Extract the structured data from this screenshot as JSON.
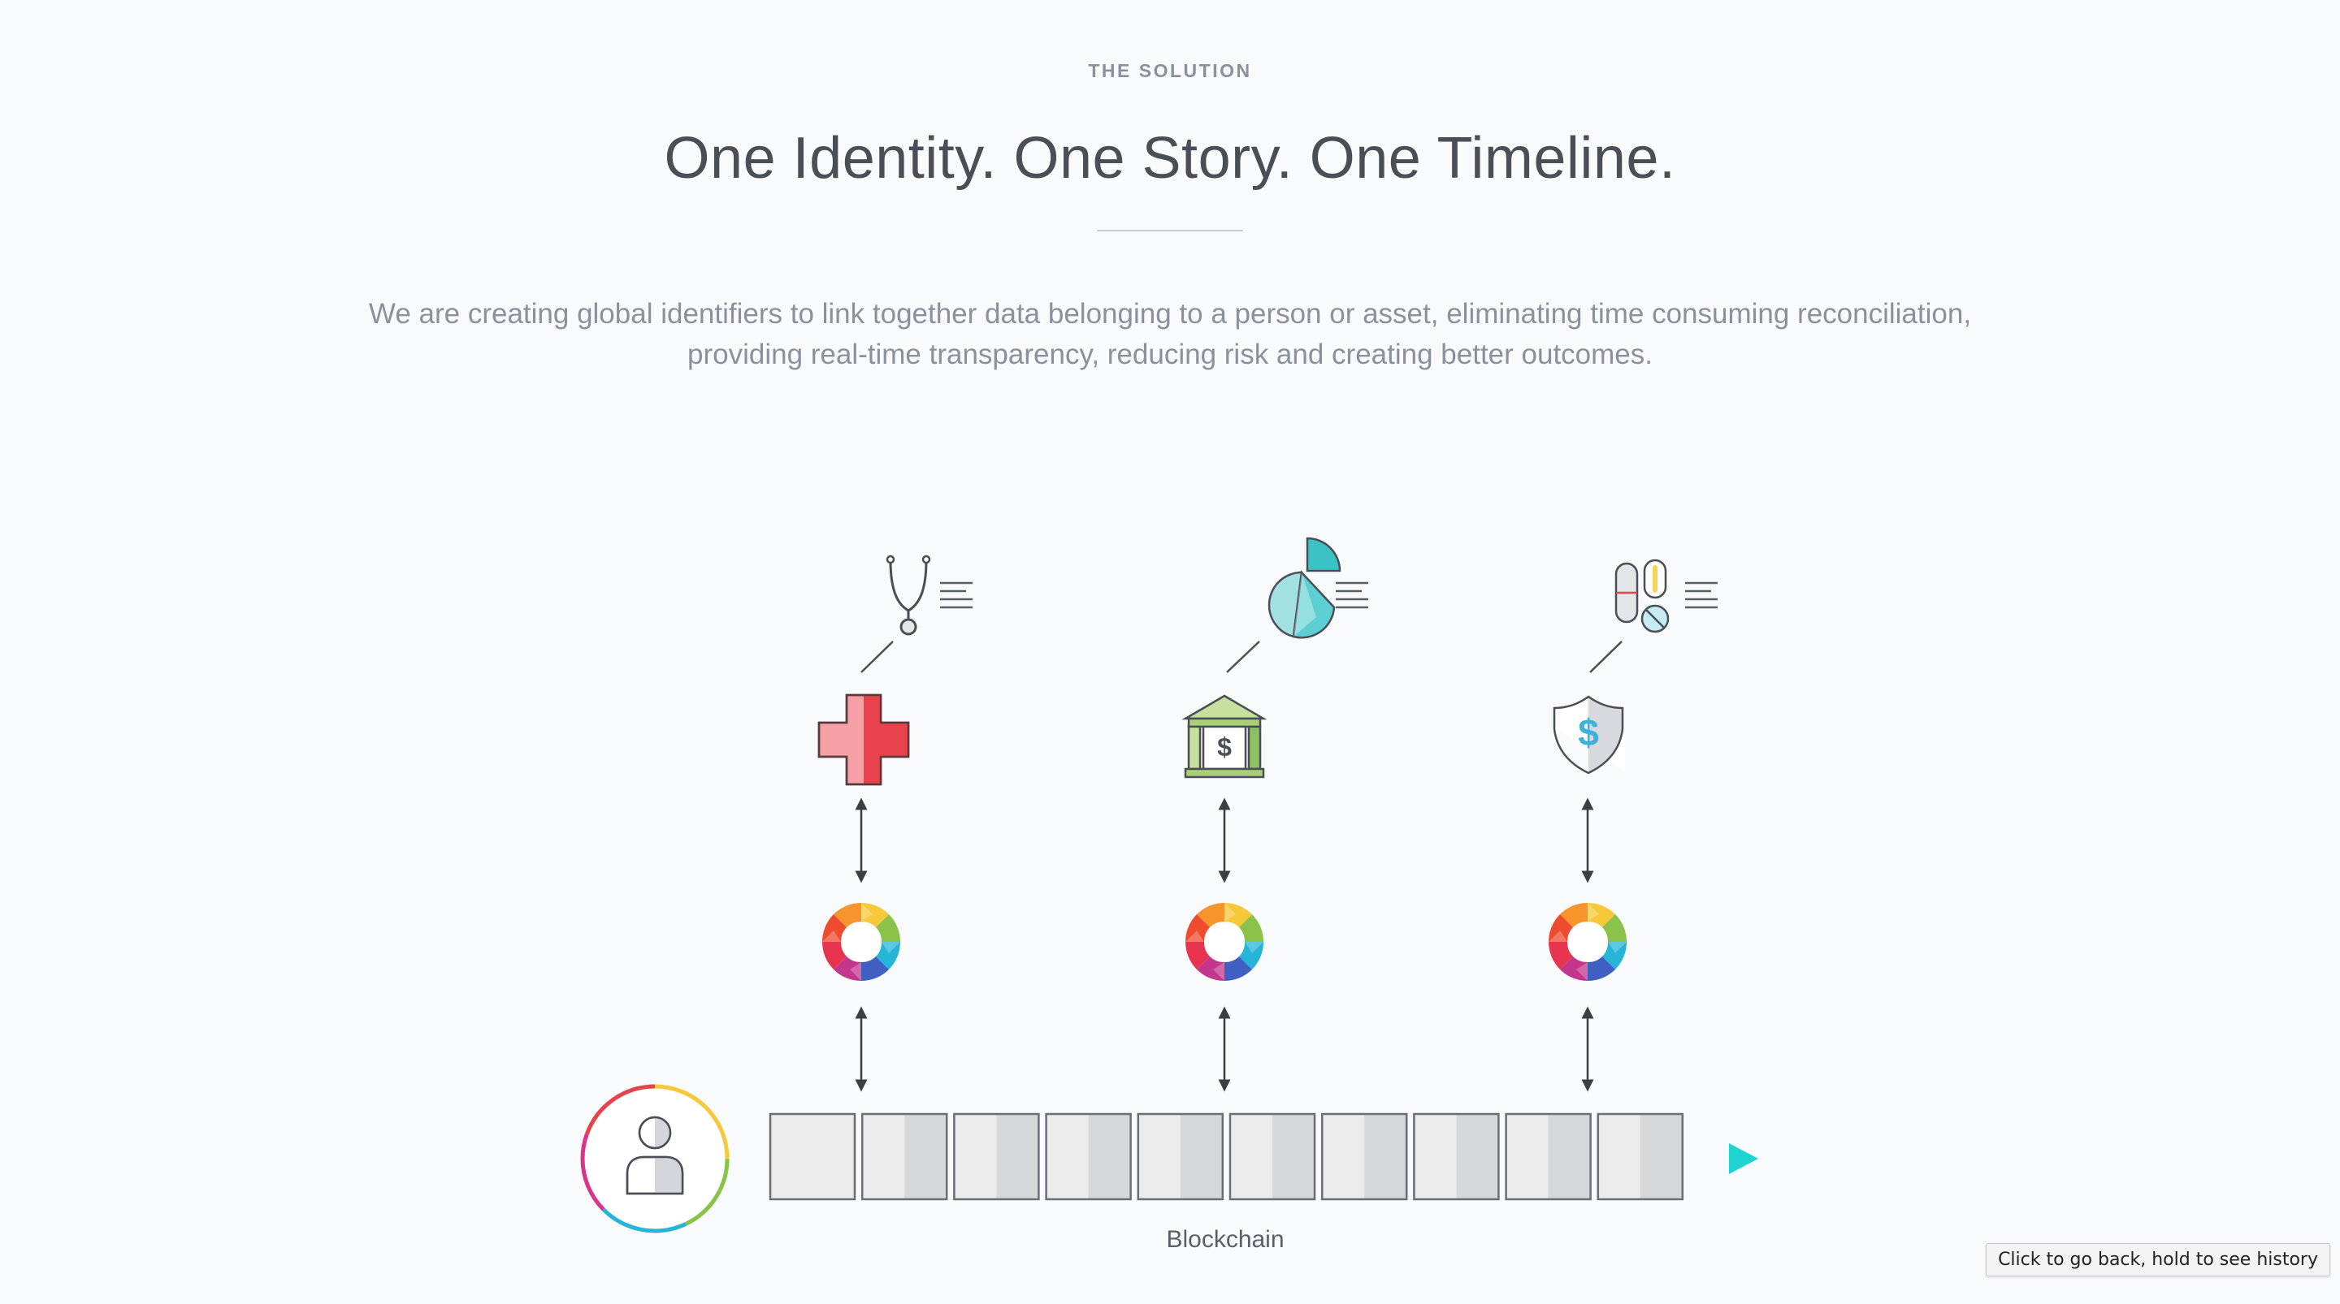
{
  "section": {
    "eyebrow": "THE SOLUTION",
    "headline": "One Identity. One Story. One Timeline.",
    "description_lines": [
      "We are creating global identifiers to link together data belonging to a person or asset, eliminating time consuming reconciliation,",
      "providing real-time transparency, reducing risk and creating better outcomes."
    ]
  },
  "diagram": {
    "columns": [
      {
        "record_icon": "stethoscope-icon",
        "org_icon": "medical-cross-icon"
      },
      {
        "record_icon": "pie-chart-icon",
        "org_icon": "bank-icon"
      },
      {
        "record_icon": "pills-icon",
        "org_icon": "insurance-shield-icon"
      }
    ],
    "identity_icon": "person-icon",
    "hub_icon": "identity-ring-icon",
    "chain_label": "Blockchain",
    "block_count": 10,
    "colors": {
      "medical": "#e8434d",
      "bank": "#8dc063",
      "shield_dollar": "#3fb0d8",
      "timeline_start": "#2f86c8",
      "timeline_end": "#1fd3d0",
      "chart_teal": "#3cc1c4"
    }
  },
  "browser": {
    "back_tooltip": "Click to go back, hold to see history"
  }
}
